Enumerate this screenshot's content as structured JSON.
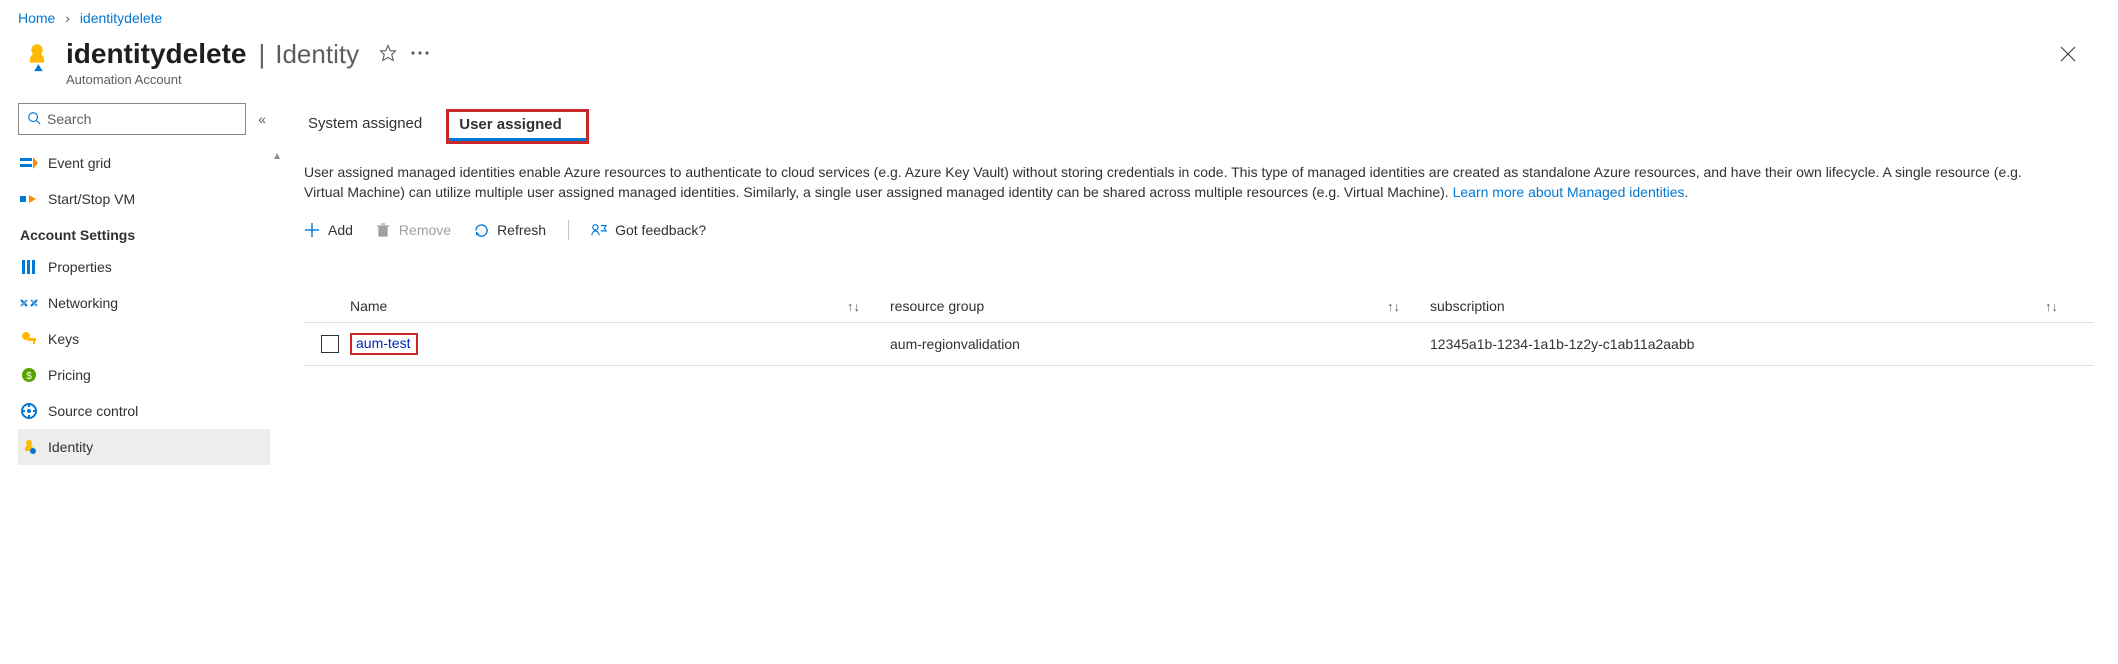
{
  "breadcrumb": {
    "home": "Home",
    "current": "identitydelete"
  },
  "header": {
    "title_main": "identitydelete",
    "title_sub": "Identity",
    "resource_type": "Automation Account"
  },
  "sidebar": {
    "search_placeholder": "Search",
    "items": [
      {
        "label": "Event grid",
        "icon": "event-grid-icon"
      },
      {
        "label": "Start/Stop VM",
        "icon": "start-stop-vm-icon"
      }
    ],
    "section_label": "Account Settings",
    "settings_items": [
      {
        "label": "Properties",
        "icon": "properties-icon"
      },
      {
        "label": "Networking",
        "icon": "networking-icon"
      },
      {
        "label": "Keys",
        "icon": "keys-icon"
      },
      {
        "label": "Pricing",
        "icon": "pricing-icon"
      },
      {
        "label": "Source control",
        "icon": "source-control-icon"
      },
      {
        "label": "Identity",
        "icon": "identity-icon",
        "active": true
      }
    ]
  },
  "tabs": {
    "system": "System assigned",
    "user": "User assigned"
  },
  "description": {
    "text": "User assigned managed identities enable Azure resources to authenticate to cloud services (e.g. Azure Key Vault) without storing credentials in code. This type of managed identities are created as standalone Azure resources, and have their own lifecycle. A single resource (e.g. Virtual Machine) can utilize multiple user assigned managed identities. Similarly, a single user assigned managed identity can be shared across multiple resources (e.g. Virtual Machine). ",
    "link": "Learn more about Managed identities"
  },
  "toolbar": {
    "add": "Add",
    "remove": "Remove",
    "refresh": "Refresh",
    "feedback": "Got feedback?"
  },
  "table": {
    "headers": {
      "name": "Name",
      "rg": "resource group",
      "sub": "subscription"
    },
    "rows": [
      {
        "name": "aum-test",
        "rg": "aum-regionvalidation",
        "sub": "12345a1b-1234-1a1b-1z2y-c1ab11a2aabb"
      }
    ]
  }
}
